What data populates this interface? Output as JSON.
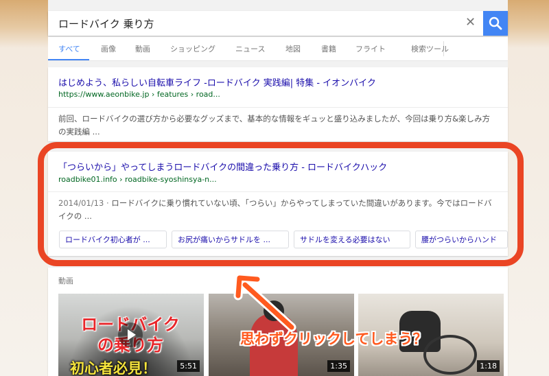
{
  "search": {
    "query": "ロードバイク 乗り方"
  },
  "tabs": [
    {
      "label": "すべて",
      "active": true
    },
    {
      "label": "画像"
    },
    {
      "label": "動画"
    },
    {
      "label": "ショッピング"
    },
    {
      "label": "ニュース"
    },
    {
      "label": "地図"
    },
    {
      "label": "書籍"
    },
    {
      "label": "フライト"
    },
    {
      "label": "検索ツール"
    }
  ],
  "results": [
    {
      "title": "はじめよう、私らしい自転車ライフ -ロードバイク 実践編| 特集 - イオンバイク",
      "url": "https://www.aeonbike.jp › features › road...",
      "snippet": "前回、ロードバイクの選び方から必要なグッズまで、基本的な情報をギュッと盛り込みましたが、今回は乗り方&楽しみ方の実践編 ..."
    },
    {
      "title": "「つらいから」やってしまうロードバイクの間違った乗り方 - ロードバイクハック",
      "url": "roadbike01.info › roadbike-syoshinsya-n...",
      "date": "2014/01/13 · ",
      "snippet": "ロードバイクに乗り慣れていない頃、「つらい」からやってしまっていた間違いがあります。今ではロードバイクの ...",
      "chips": [
        "ロードバイク初心者が ...",
        "お尻が痛いからサドルを ...",
        "サドルを変える必要はない",
        "腰がつらいからハンド"
      ]
    }
  ],
  "videos": {
    "label": "動画",
    "items": [
      {
        "duration": "5:51",
        "overlay_line1": "ロードバイク",
        "overlay_line2": "の乗り方",
        "overlay_line3": "初心者必見！"
      },
      {
        "duration": "1:35"
      },
      {
        "duration": "1:18"
      }
    ]
  },
  "annotation": {
    "callout": "思わずクリックしてしまう？"
  },
  "colors": {
    "accent": "#4285f4",
    "link": "#1a0dab",
    "url": "#006621",
    "highlight": "#ea4524",
    "callout": "#ff5a1f"
  },
  "icons": [
    "clear-icon",
    "search-icon",
    "play-icon",
    "arrow-icon"
  ]
}
